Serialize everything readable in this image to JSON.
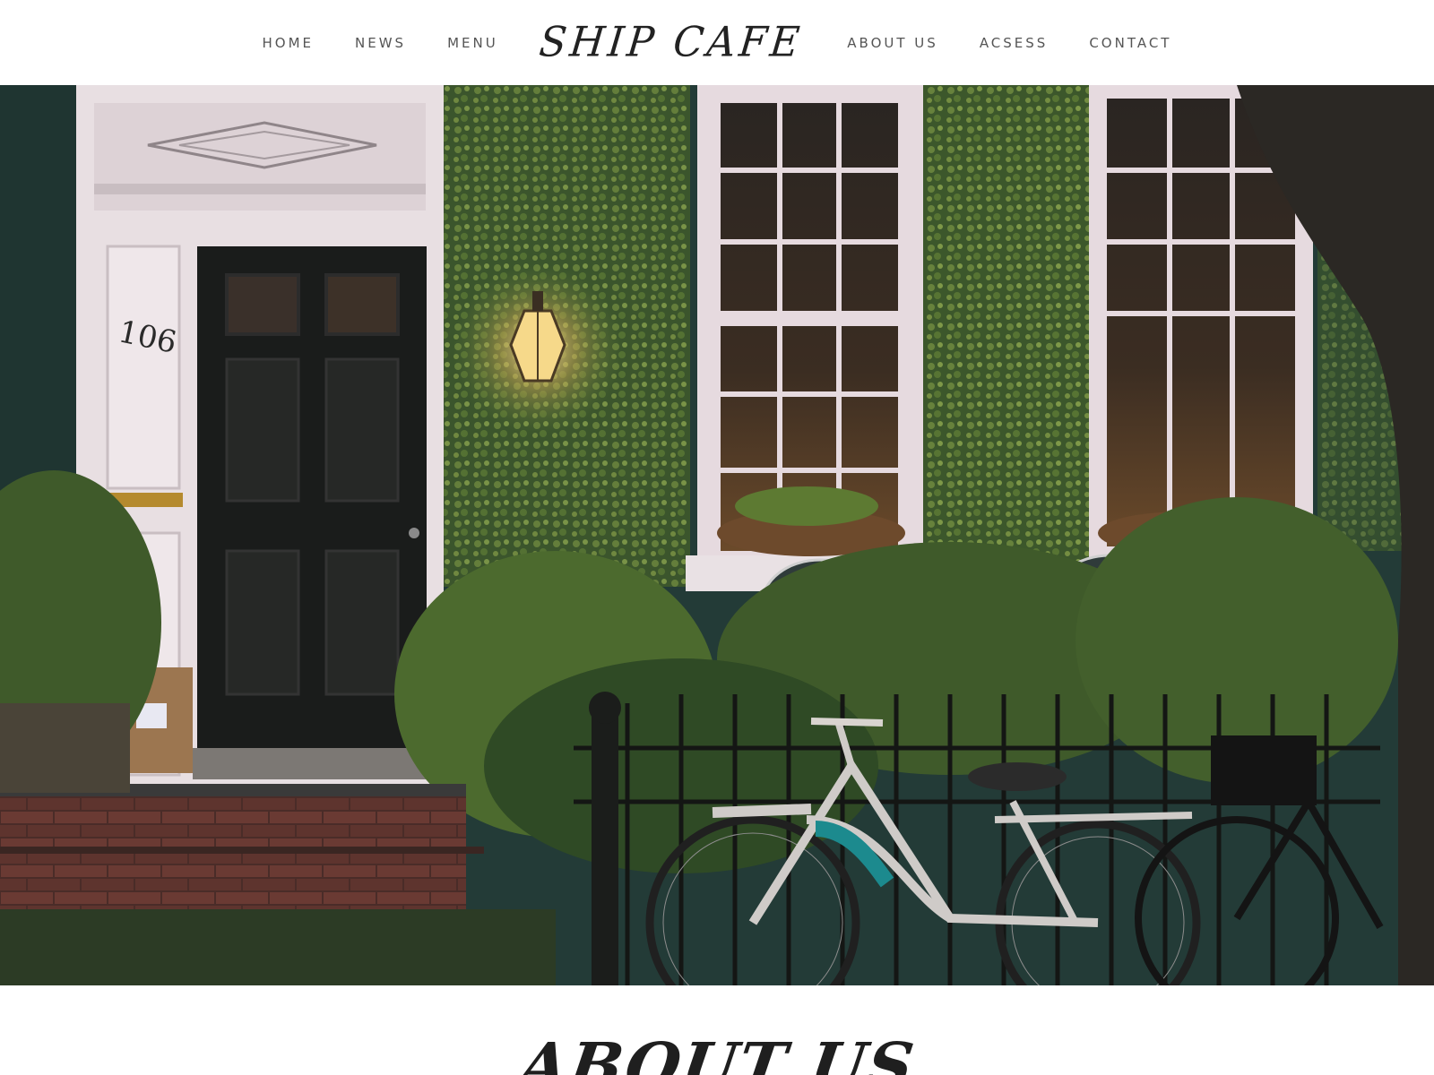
{
  "nav": {
    "left": [
      {
        "label": "HOME"
      },
      {
        "label": "NEWS"
      },
      {
        "label": "MENU"
      }
    ],
    "logo": "SHIP CAFE",
    "right": [
      {
        "label": "ABOUT US"
      },
      {
        "label": "ACSESS"
      },
      {
        "label": "CONTACT"
      }
    ]
  },
  "hero": {
    "house_number": "106"
  },
  "about": {
    "title": "ABOUT US"
  },
  "colors": {
    "wall": "#233b37",
    "ivy": "#6f8a3c",
    "trim": "#e8dfe2",
    "door": "#1a1c1b",
    "brick": "#5a3530"
  }
}
